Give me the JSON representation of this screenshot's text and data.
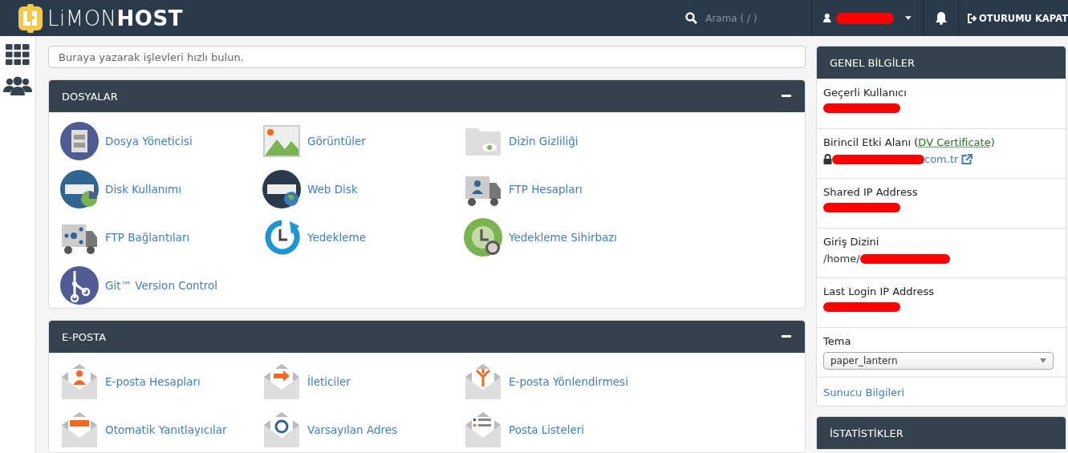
{
  "header": {
    "logo_light": "LiMON",
    "logo_bold": "HOST",
    "search_placeholder": "Arama ( / )",
    "user_redacted": true,
    "logout": "OTURUMU KAPAT"
  },
  "quick_search": {
    "placeholder": "Buraya yazarak işlevleri hızlı bulun."
  },
  "sections": [
    {
      "title": "DOSYALAR",
      "expanded": true,
      "items": [
        {
          "label": "Dosya Yöneticisi"
        },
        {
          "label": "Görüntüler"
        },
        {
          "label": "Dizin Gizliliği"
        },
        {
          "label": "Disk Kullanımı"
        },
        {
          "label": "Web Disk"
        },
        {
          "label": "FTP Hesapları"
        },
        {
          "label": "FTP Bağlantıları"
        },
        {
          "label": "Yedekleme"
        },
        {
          "label": "Yedekleme Sihirbazı"
        },
        {
          "label": "Git™ Version Control"
        }
      ]
    },
    {
      "title": "E-POSTA",
      "expanded": true,
      "items": [
        {
          "label": "E-posta Hesapları"
        },
        {
          "label": "İleticiler"
        },
        {
          "label": "E-posta Yönlendirmesi"
        },
        {
          "label": "Otomatik Yanıtlayıcılar"
        },
        {
          "label": "Varsayılan Adres"
        },
        {
          "label": "Posta Listeleri"
        }
      ]
    }
  ],
  "general_info": {
    "title": "GENEL BİLGİLER",
    "rows": [
      {
        "kind": "text",
        "label": "Geçerli Kullanıcı",
        "redacted": true
      },
      {
        "kind": "domain",
        "label": "Birincil Etki Alanı (",
        "label_abbr": "DV Certificate",
        "label_end": ")",
        "value": "com.tr",
        "redacted": true
      },
      {
        "kind": "text",
        "label": "Shared IP Address",
        "redacted": true
      },
      {
        "kind": "text",
        "label": "Giriş Dizini",
        "value": "/home/",
        "redacted": true
      },
      {
        "kind": "text",
        "label": "Last Login IP Address",
        "redacted": true
      },
      {
        "kind": "select",
        "label": "Tema",
        "value": "paper_lantern"
      },
      {
        "kind": "link",
        "label": "Sunucu Bilgileri"
      }
    ]
  },
  "stats": {
    "title": "İSTATİSTİKLER"
  }
}
